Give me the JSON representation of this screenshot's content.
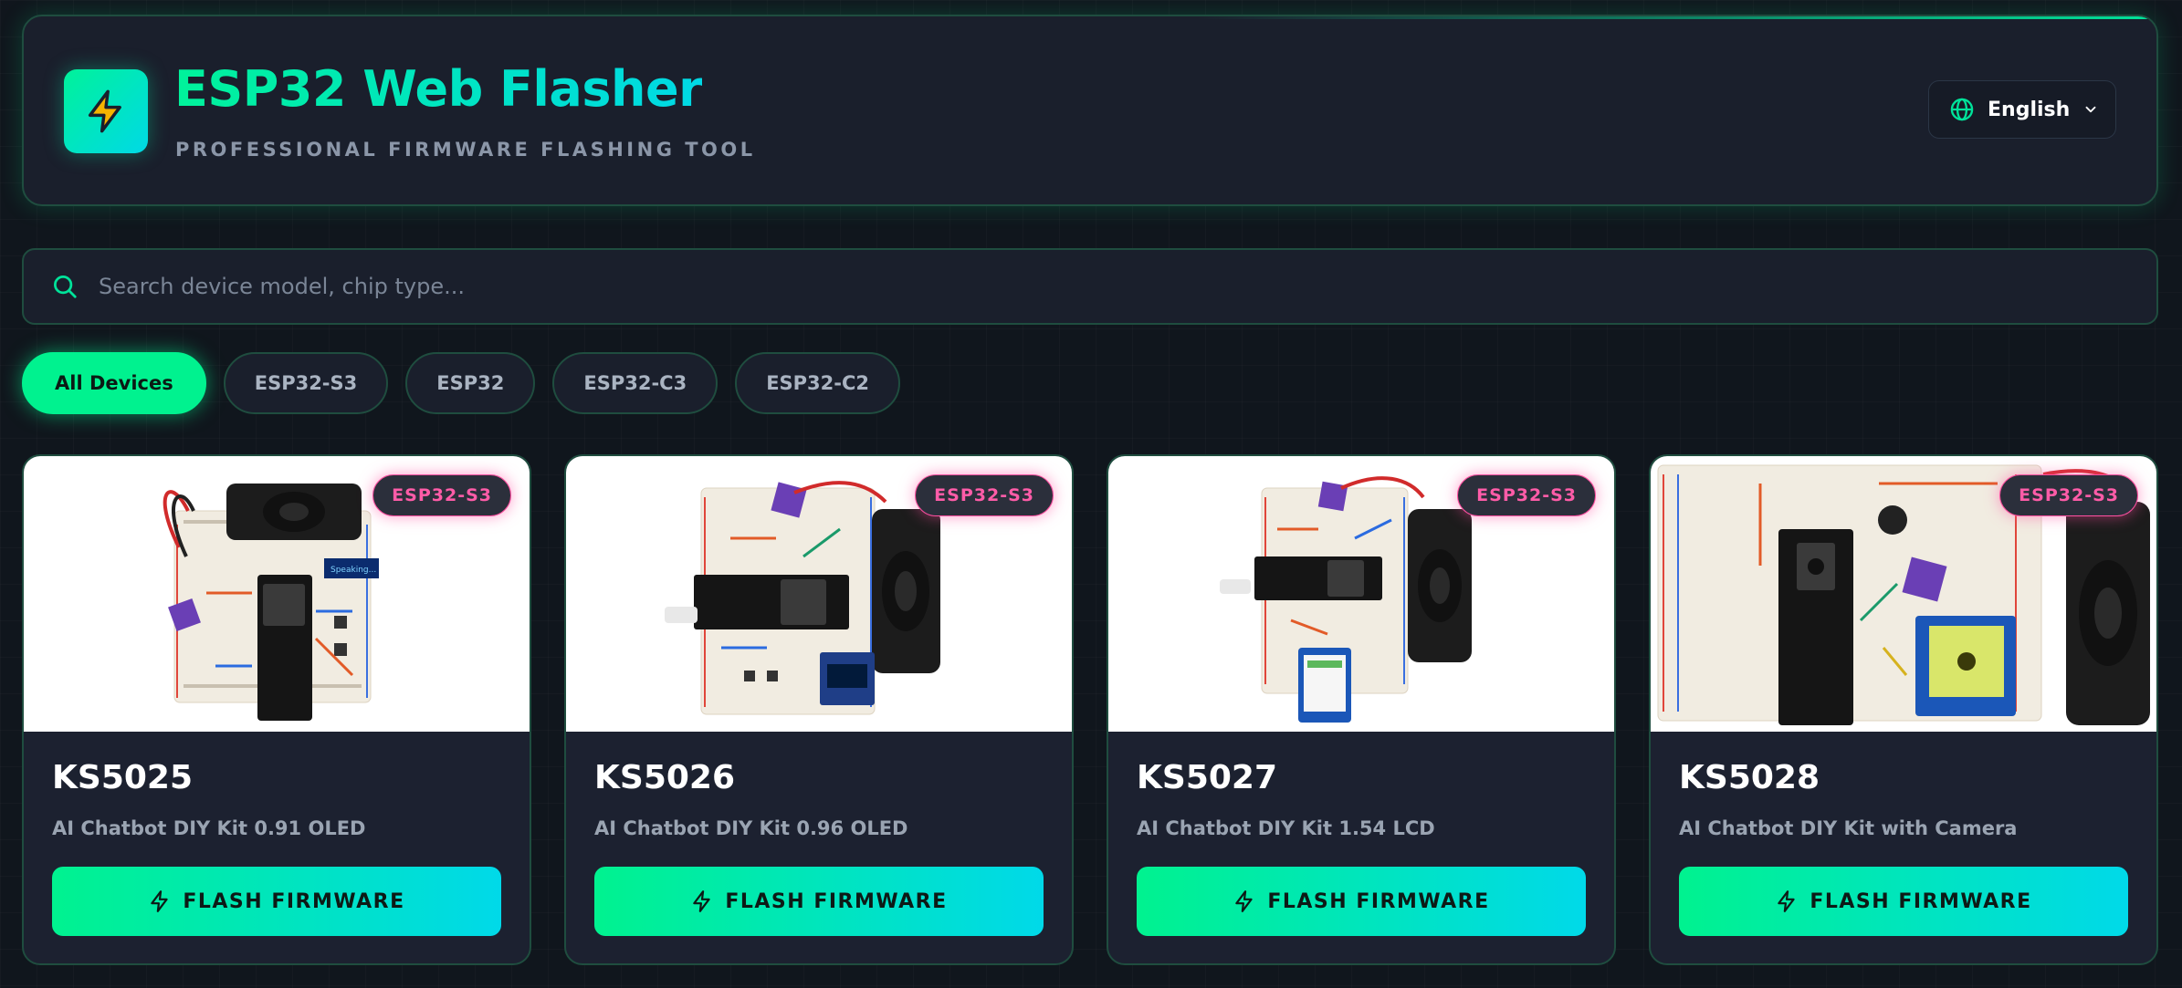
{
  "header": {
    "title": "ESP32 Web Flasher",
    "subtitle": "PROFESSIONAL FIRMWARE FLASHING TOOL",
    "logo_icon": "lightning-bolt-icon",
    "language": {
      "label": "English",
      "icon": "globe-icon"
    }
  },
  "search": {
    "placeholder": "Search device model, chip type...",
    "value": ""
  },
  "filters": [
    {
      "label": "All Devices",
      "active": true
    },
    {
      "label": "ESP32-S3",
      "active": false
    },
    {
      "label": "ESP32",
      "active": false
    },
    {
      "label": "ESP32-C3",
      "active": false
    },
    {
      "label": "ESP32-C2",
      "active": false
    }
  ],
  "devices": [
    {
      "model": "KS5025",
      "description": "AI Chatbot DIY Kit 0.91 OLED",
      "chip": "ESP32-S3",
      "button": "FLASH FIRMWARE"
    },
    {
      "model": "KS5026",
      "description": "AI Chatbot DIY Kit 0.96 OLED",
      "chip": "ESP32-S3",
      "button": "FLASH FIRMWARE"
    },
    {
      "model": "KS5027",
      "description": "AI Chatbot DIY Kit 1.54 LCD",
      "chip": "ESP32-S3",
      "button": "FLASH FIRMWARE"
    },
    {
      "model": "KS5028",
      "description": "AI Chatbot DIY Kit with Camera",
      "chip": "ESP32-S3",
      "button": "FLASH FIRMWARE"
    }
  ],
  "colors": {
    "accent_green": "#00f28f",
    "accent_cyan": "#00d9e9",
    "chip_badge_pink": "#ff5ca8",
    "background": "#10161d",
    "panel": "#1a1f2c"
  }
}
